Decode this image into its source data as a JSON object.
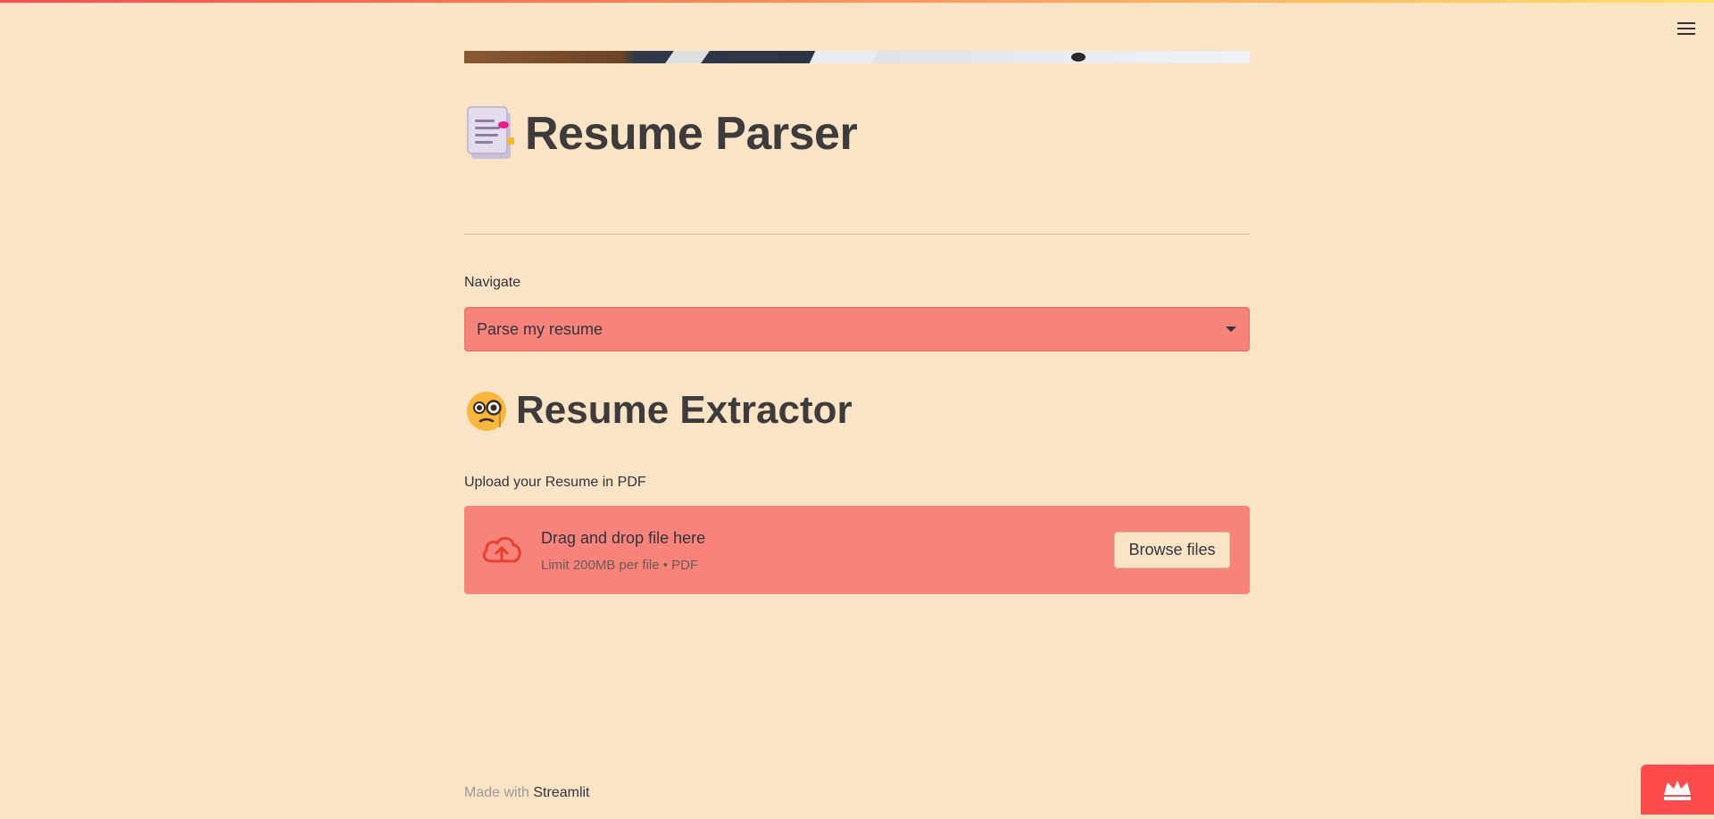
{
  "app": {
    "title": "Resume Parser",
    "title_icon": "document-emoji-icon"
  },
  "header": {
    "menu_icon": "hamburger-menu-icon"
  },
  "navigate": {
    "label": "Navigate",
    "selected": "Parse my resume"
  },
  "section": {
    "title": "Resume Extractor",
    "icon": "face-monocle-emoji-icon"
  },
  "upload": {
    "label": "Upload your Resume in PDF",
    "drag_text": "Drag and drop file here",
    "limit_text": "Limit 200MB per file • PDF",
    "browse_label": "Browse files"
  },
  "footer": {
    "made_with": "Made with",
    "brand": "Streamlit"
  },
  "colors": {
    "background": "#fbe4c6",
    "accent": "#f8837a",
    "brand_red": "#ff4b4b",
    "text": "#31333f"
  }
}
